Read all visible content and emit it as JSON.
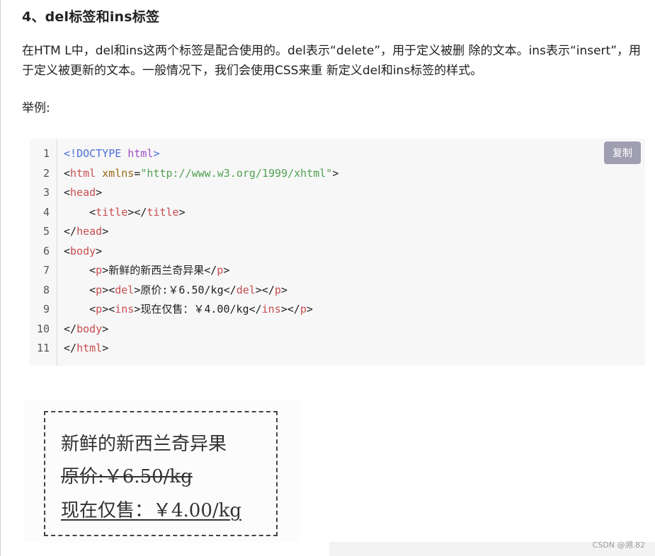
{
  "heading": "4、del标签和ins标签",
  "paragraph": "在HTM L中，del和ins这两个标签是配合使用的。del表示“delete”，用于定义被删 除的文本。ins表示“insert”，用于定义被更新的文本。一般情况下，我们会使用CSS来重 新定义del和ins标签的样式。",
  "example_label": "举例:",
  "copy_button": "复制",
  "code": {
    "line_numbers": [
      "1",
      "2",
      "3",
      "4",
      "5",
      "6",
      "7",
      "8",
      "9",
      "10",
      "11"
    ],
    "l1": {
      "open": "<!",
      "doctype": "DOCTYPE",
      "name": " html",
      "close": ">"
    },
    "l2": {
      "lt": "<",
      "tag": "html",
      "attr": " xmlns",
      "eq": "=",
      "str": "\"http://www.w3.org/1999/xhtml\"",
      "gt": ">"
    },
    "l3": {
      "lt": "<",
      "tag": "head",
      "gt": ">"
    },
    "l4": {
      "indent": "    ",
      "lt1": "<",
      "tag1": "title",
      "gt1": ">",
      "lt2": "</",
      "tag2": "title",
      "gt2": ">"
    },
    "l5": {
      "lt": "</",
      "tag": "head",
      "gt": ">"
    },
    "l6": {
      "lt": "<",
      "tag": "body",
      "gt": ">"
    },
    "l7": {
      "indent": "    ",
      "lt1": "<",
      "tag1": "p",
      "gt1": ">",
      "text": "新鲜的新西兰奇异果",
      "lt2": "</",
      "tag2": "p",
      "gt2": ">"
    },
    "l8": {
      "indent": "    ",
      "lt1": "<",
      "tag1": "p",
      "gt1": "><",
      "tag2": "del",
      "gt2": ">",
      "text": "原价:￥6.50/kg",
      "lt3": "</",
      "tag3": "del",
      "gt3": "></",
      "tag4": "p",
      "gt4": ">"
    },
    "l9": {
      "indent": "    ",
      "lt1": "<",
      "tag1": "p",
      "gt1": "><",
      "tag2": "ins",
      "gt2": ">",
      "text": "现在仅售：￥4.00/kg",
      "lt3": "</",
      "tag3": "ins",
      "gt3": "></",
      "tag4": "p",
      "gt4": ">"
    },
    "l10": {
      "lt": "</",
      "tag": "body",
      "gt": ">"
    },
    "l11": {
      "lt": "</",
      "tag": "html",
      "gt": ">"
    }
  },
  "rendered": {
    "line1": "新鲜的新西兰奇异果",
    "line2": "原价:￥6.50/kg",
    "line3": "现在仅售：￥4.00/kg"
  },
  "watermark": "CSDN @溯.82"
}
